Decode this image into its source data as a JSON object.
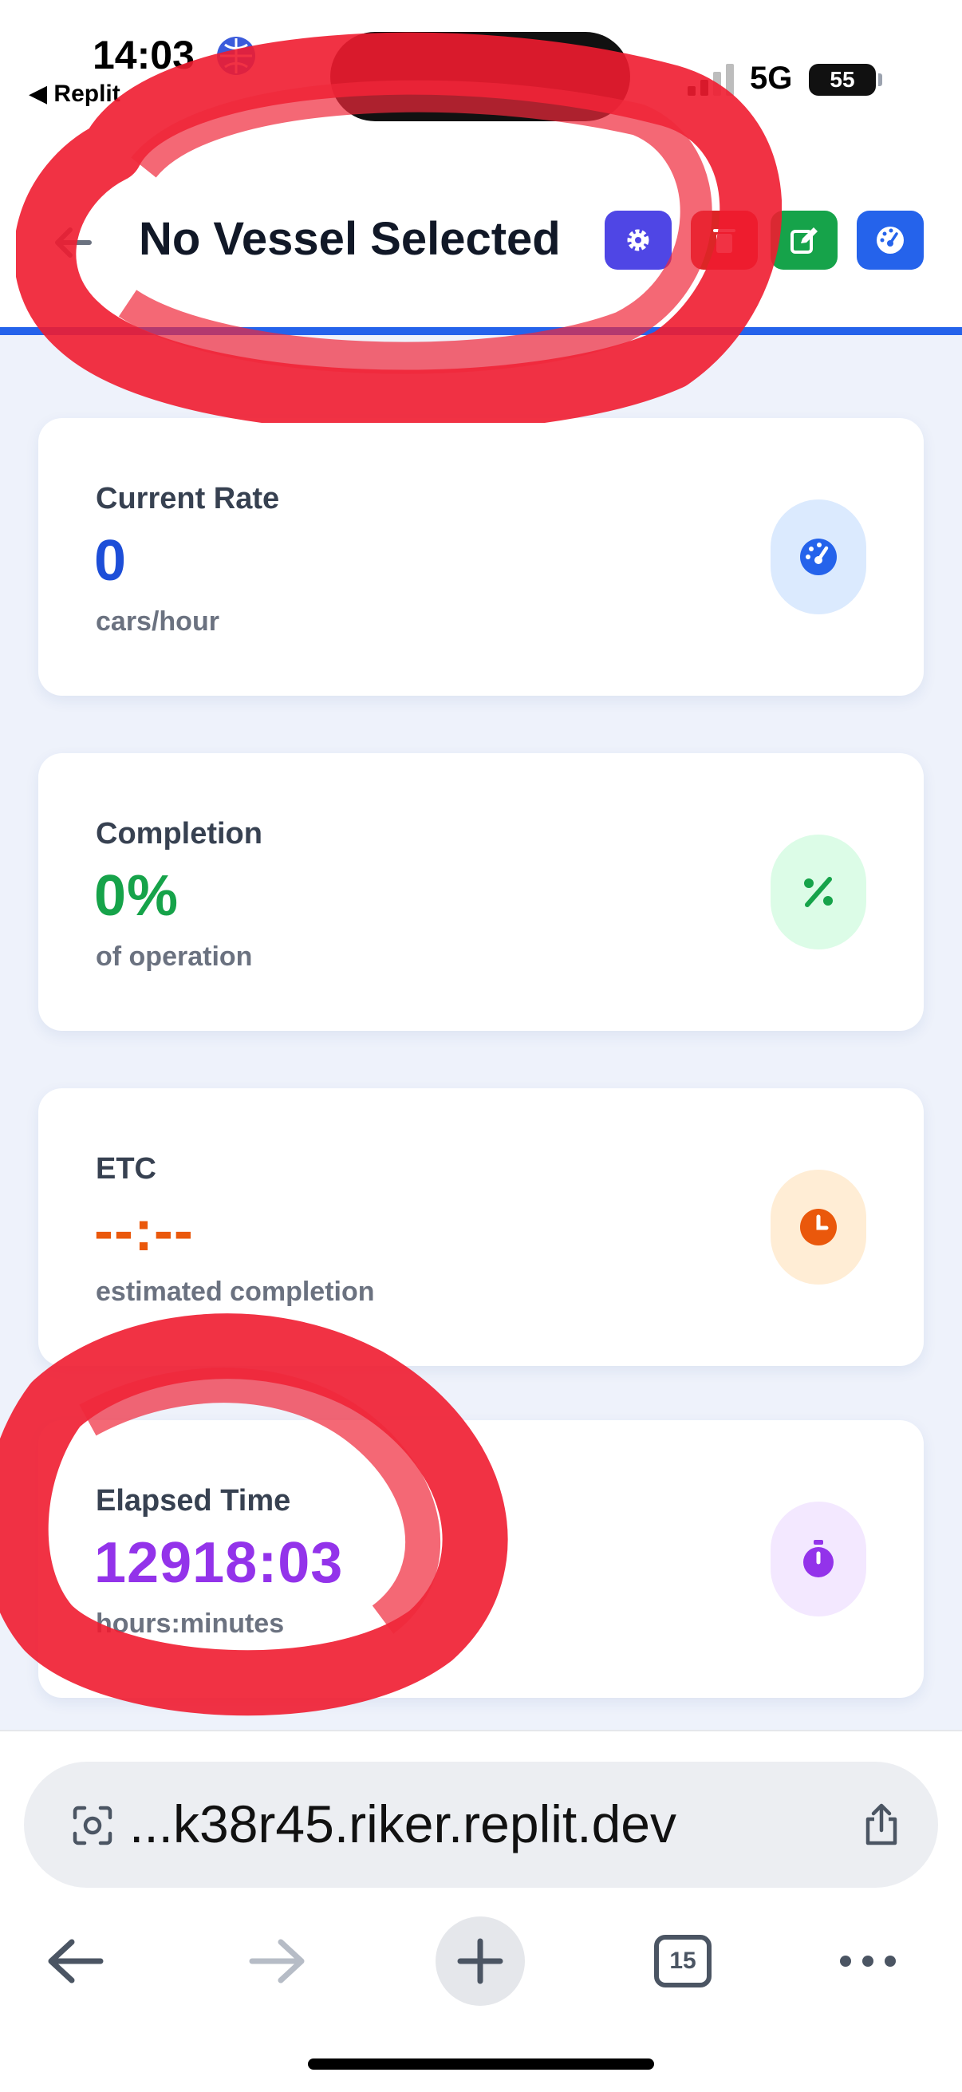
{
  "status_bar": {
    "time": "14:03",
    "back_app": "◀ Replit",
    "network": "5G",
    "battery": "55"
  },
  "header": {
    "title": "No Vessel Selected",
    "accent_color": "#2563eb",
    "buttons": [
      {
        "name": "settings",
        "icon": "gear-icon",
        "color": "#4f46e5"
      },
      {
        "name": "delete",
        "icon": "trash-icon",
        "color": "#dc2626"
      },
      {
        "name": "edit",
        "icon": "edit-icon",
        "color": "#16a34a"
      },
      {
        "name": "dashboard",
        "icon": "gauge-icon",
        "color": "#2563eb"
      }
    ]
  },
  "cards": {
    "rate": {
      "label": "Current Rate",
      "value": "0",
      "unit": "cars/hour",
      "icon": "gauge-icon",
      "color": "#1d4ed8"
    },
    "completion": {
      "label": "Completion",
      "value": "0%",
      "unit": "of operation",
      "icon": "percent-icon",
      "color": "#16a34a"
    },
    "etc": {
      "label": "ETC",
      "value": "--:--",
      "unit": "estimated completion",
      "icon": "clock-icon",
      "color": "#ea580c"
    },
    "elapsed": {
      "label": "Elapsed Time",
      "value": "12918:03",
      "unit": "hours:minutes",
      "icon": "stopwatch-icon",
      "color": "#9333ea"
    }
  },
  "browser": {
    "url": "...k38r45.riker.replit.dev",
    "tab_count": "15"
  }
}
